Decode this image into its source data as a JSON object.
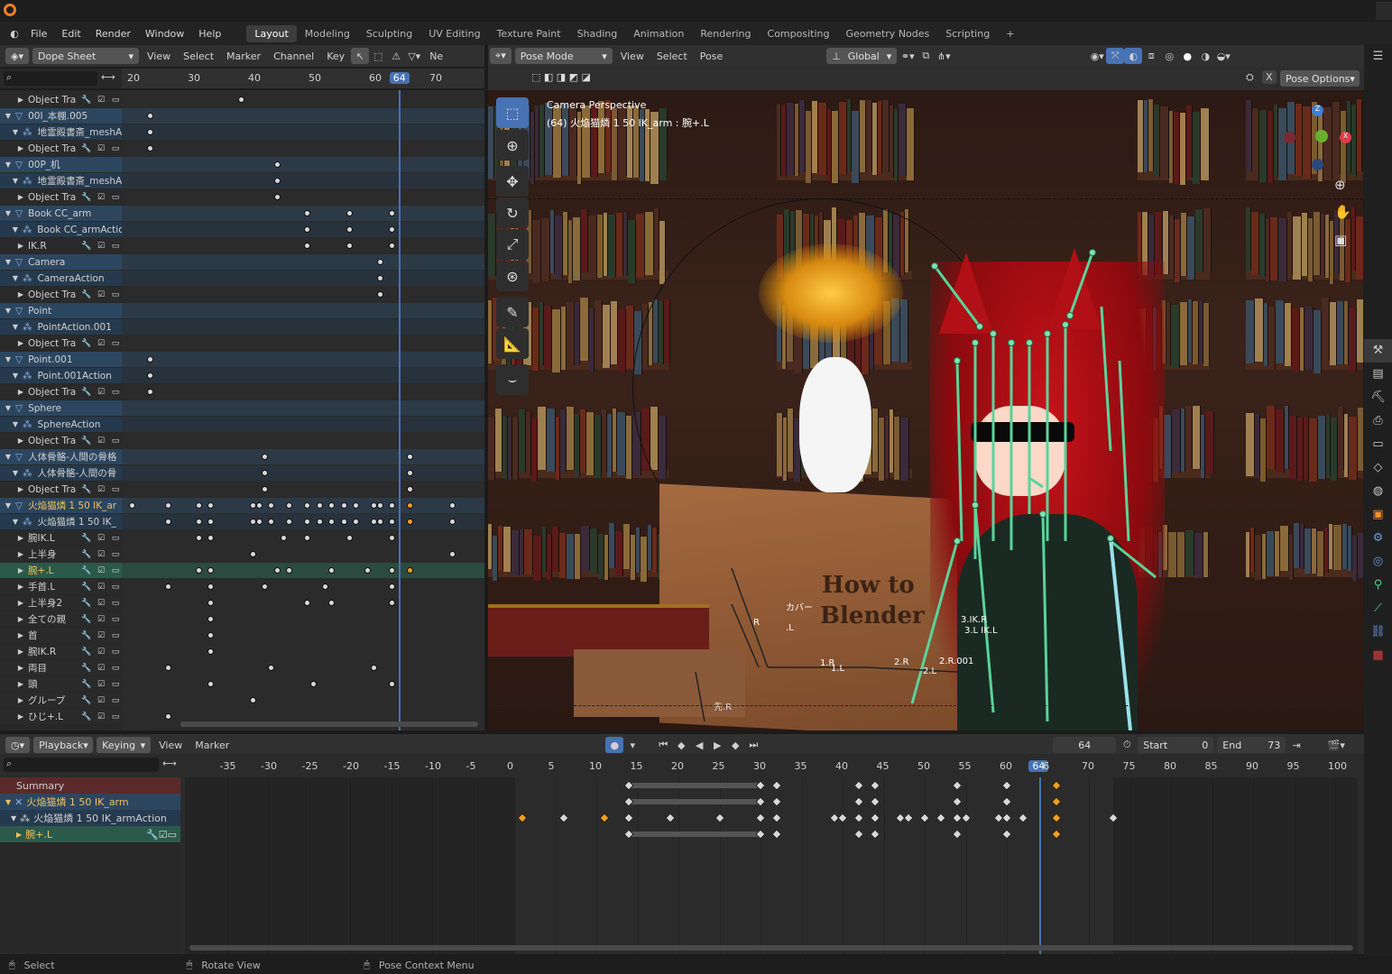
{
  "menu": {
    "items": [
      "File",
      "Edit",
      "Render",
      "Window",
      "Help"
    ],
    "workspaces": [
      "Layout",
      "Modeling",
      "Sculpting",
      "UV Editing",
      "Texture Paint",
      "Shading",
      "Animation",
      "Rendering",
      "Compositing",
      "Geometry Nodes",
      "Scripting"
    ],
    "active_workspace": "Layout",
    "add_label": "+"
  },
  "dopesheet": {
    "mode": "Dope Sheet",
    "menus": [
      "View",
      "Select",
      "Marker",
      "Channel",
      "Key"
    ],
    "new_label": "Ne",
    "ruler": [
      "20",
      "30",
      "40",
      "50",
      "60",
      "64",
      "70"
    ],
    "current_frame": "64",
    "channels": [
      {
        "label": "Object Tra",
        "kind": "row",
        "indent": 1
      },
      {
        "label": "00I_本棚.005",
        "kind": "obj",
        "indent": 0
      },
      {
        "label": "地霊殿書斎_meshA",
        "kind": "act",
        "indent": 1
      },
      {
        "label": "Object Tra",
        "kind": "row",
        "indent": 1
      },
      {
        "label": "00P_机",
        "kind": "obj",
        "indent": 0
      },
      {
        "label": "地霊殿書斎_meshA",
        "kind": "act",
        "indent": 1
      },
      {
        "label": "Object Tra",
        "kind": "row",
        "indent": 1
      },
      {
        "label": "Book CC_arm",
        "kind": "obj",
        "indent": 0
      },
      {
        "label": "Book CC_armActio",
        "kind": "act",
        "indent": 1
      },
      {
        "label": "IK.R",
        "kind": "row",
        "indent": 1
      },
      {
        "label": "Camera",
        "kind": "obj",
        "indent": 0
      },
      {
        "label": "CameraAction",
        "kind": "act",
        "indent": 1
      },
      {
        "label": "Object Tra",
        "kind": "row",
        "indent": 1
      },
      {
        "label": "Point",
        "kind": "obj",
        "indent": 0
      },
      {
        "label": "PointAction.001",
        "kind": "act",
        "indent": 1
      },
      {
        "label": "Object Tra",
        "kind": "row",
        "indent": 1
      },
      {
        "label": "Point.001",
        "kind": "obj",
        "indent": 0
      },
      {
        "label": "Point.001Action",
        "kind": "act",
        "indent": 1
      },
      {
        "label": "Object Tra",
        "kind": "row",
        "indent": 1
      },
      {
        "label": "Sphere",
        "kind": "obj",
        "indent": 0
      },
      {
        "label": "SphereAction",
        "kind": "act",
        "indent": 1
      },
      {
        "label": "Object Tra",
        "kind": "row",
        "indent": 1
      },
      {
        "label": "人体骨骼-人間の骨格",
        "kind": "obj",
        "indent": 0
      },
      {
        "label": "人体骨骼-人間の骨",
        "kind": "act",
        "indent": 1
      },
      {
        "label": "Object Tra",
        "kind": "row",
        "indent": 1
      },
      {
        "label": "火焔猫燐 1 50 IK_ar",
        "kind": "arm",
        "indent": 0
      },
      {
        "label": "火焔猫燐 1 50 IK_",
        "kind": "act",
        "indent": 1
      },
      {
        "label": "腕IK.L",
        "kind": "row",
        "indent": 1
      },
      {
        "label": "上半身",
        "kind": "row",
        "indent": 1
      },
      {
        "label": "腕+.L",
        "kind": "sel",
        "indent": 1
      },
      {
        "label": "手首.L",
        "kind": "row",
        "indent": 1
      },
      {
        "label": "上半身2",
        "kind": "row",
        "indent": 1
      },
      {
        "label": "全ての親",
        "kind": "row",
        "indent": 1
      },
      {
        "label": "首",
        "kind": "row",
        "indent": 1
      },
      {
        "label": "腕IK.R",
        "kind": "row",
        "indent": 1
      },
      {
        "label": "両目",
        "kind": "row",
        "indent": 1
      },
      {
        "label": "頭",
        "kind": "row",
        "indent": 1
      },
      {
        "label": "グルーブ",
        "kind": "row",
        "indent": 1
      },
      {
        "label": "ひじ+.L",
        "kind": "row",
        "indent": 1
      }
    ]
  },
  "viewport": {
    "mode": "Pose Mode",
    "menus": [
      "View",
      "Select",
      "Pose"
    ],
    "orientation": "Global",
    "pose_options": "Pose Options",
    "overlay_title": "Camera Perspective",
    "overlay_subtitle": "(64) 火焔猫燐 1 50 IK_arm : 腕+.L",
    "book_title_line1": "How to",
    "book_title_line2": "Blender",
    "bone_labels": [
      "カバー",
      "R",
      ".L",
      "1.R",
      "1.L",
      "2.R",
      "2.L",
      "2.R.001",
      "先.R",
      "3.IK.R",
      "3.L IK.L"
    ]
  },
  "timeline": {
    "menus": [
      "Playback",
      "Keying",
      "View",
      "Marker"
    ],
    "current_frame": "64",
    "start_label": "Start",
    "start_value": "0",
    "end_label": "End",
    "end_value": "73",
    "ruler": [
      "-35",
      "-30",
      "-25",
      "-20",
      "-15",
      "-10",
      "-5",
      "0",
      "5",
      "10",
      "15",
      "20",
      "25",
      "30",
      "35",
      "40",
      "45",
      "50",
      "55",
      "60",
      "64",
      "6",
      "70",
      "75",
      "80",
      "85",
      "90",
      "95",
      "100"
    ],
    "channels": [
      "Summary",
      "火焔猫燐 1 50 IK_arm",
      "火焔猫燐 1 50 IK_armAction",
      "腕+.L"
    ]
  },
  "status": {
    "items": [
      "Select",
      "Rotate View",
      "Pose Context Menu"
    ]
  },
  "colors": {
    "accent": "#4772b3",
    "selected_key": "#f0a020",
    "object_row": "#2c4660",
    "selected_row": "#2b5a4a"
  }
}
